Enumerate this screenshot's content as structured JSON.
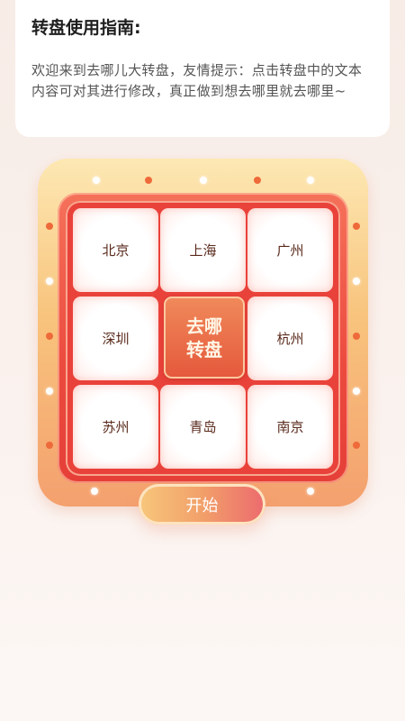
{
  "guide": {
    "title": "转盘使用指南:",
    "text": "欢迎来到去哪儿大转盘，友情提示：点击转盘中的文本内容可对其进行修改，真正做到想去哪里就去哪里~"
  },
  "wheel": {
    "cells": [
      "北京",
      "上海",
      "广州",
      "深圳",
      "杭州",
      "苏州",
      "青岛",
      "南京"
    ],
    "center_line1": "去哪",
    "center_line2": "转盘"
  },
  "start_label": "开始",
  "colors": {
    "accent_red": "#e9423a",
    "frame_gold": "#f8c47d",
    "text_dark": "#1f1f1f"
  }
}
